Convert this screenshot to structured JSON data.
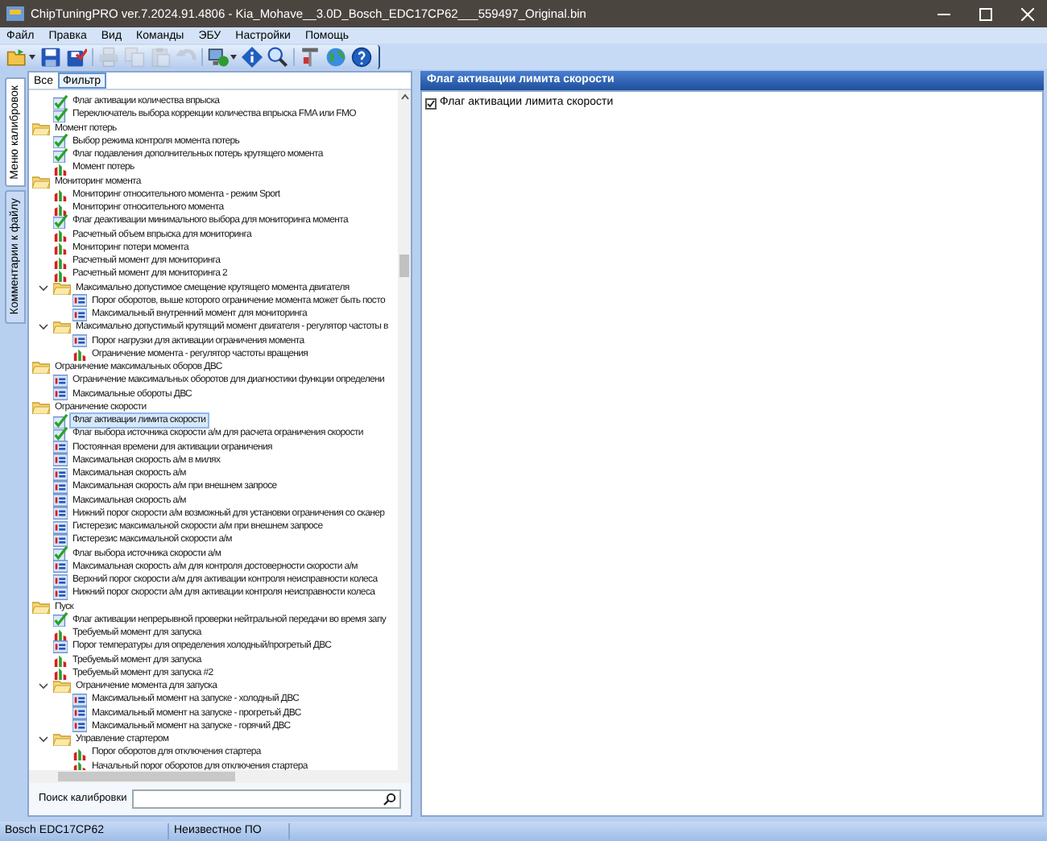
{
  "window": {
    "title": "ChipTuningPRO ver.7.2024.91.4806 - Kia_Mohave__3.0D_Bosch_EDC17CP62___559497_Original.bin"
  },
  "menu": [
    "Файл",
    "Правка",
    "Вид",
    "Команды",
    "ЭБУ",
    "Настройки",
    "Помощь"
  ],
  "toolbar": [
    {
      "kind": "open",
      "disabled": false,
      "dropdown": true
    },
    {
      "kind": "save",
      "disabled": false,
      "dropdown": false
    },
    {
      "kind": "save-as",
      "disabled": false,
      "dropdown": false
    },
    {
      "kind": "print",
      "disabled": true,
      "dropdown": false
    },
    {
      "kind": "copy",
      "disabled": true,
      "dropdown": false
    },
    {
      "kind": "paste",
      "disabled": true,
      "dropdown": false
    },
    {
      "kind": "undo",
      "disabled": true,
      "dropdown": false
    },
    {
      "kind": "connect",
      "disabled": false,
      "dropdown": true
    },
    {
      "kind": "info",
      "disabled": false,
      "dropdown": false
    },
    {
      "kind": "zoom",
      "disabled": false,
      "dropdown": false
    },
    {
      "kind": "tools",
      "disabled": false,
      "dropdown": false
    },
    {
      "kind": "web",
      "disabled": false,
      "dropdown": false
    },
    {
      "kind": "help",
      "disabled": false,
      "dropdown": false
    }
  ],
  "side_tabs": [
    {
      "label": "Меню калибровок",
      "selected": true
    },
    {
      "label": "Комментарии к файлу",
      "selected": false
    }
  ],
  "filter_tabs": [
    {
      "label": "Все",
      "selected": false
    },
    {
      "label": "Фильтр",
      "selected": true
    }
  ],
  "tree": [
    {
      "kind": "continued",
      "expanded": true,
      "children": [
        {
          "kind": "flag",
          "label": "Флаг активации количества впрыска",
          "selected": false
        },
        {
          "kind": "flag",
          "label": "Переключатель выбора коррекции количества впрыска FMA или FMO",
          "selected": false
        }
      ]
    },
    {
      "kind": "folder",
      "label": "Момент потерь",
      "expanded": true,
      "children": [
        {
          "kind": "flag",
          "label": "Выбор режима контроля момента потерь",
          "selected": false
        },
        {
          "kind": "flag",
          "label": "Флаг подавления дополнительных потерь крутящего момента",
          "selected": false
        },
        {
          "kind": "curve",
          "label": "Момент потерь",
          "selected": false
        }
      ]
    },
    {
      "kind": "folder",
      "label": "Мониторинг момента",
      "expanded": true,
      "children": [
        {
          "kind": "curve",
          "label": "Мониторинг относительного момента - режим Sport",
          "selected": false
        },
        {
          "kind": "curve",
          "label": "Мониторинг относительного момента",
          "selected": false
        },
        {
          "kind": "flag",
          "label": "Флаг деактивации минимального выбора для мониторинга момента",
          "selected": false
        },
        {
          "kind": "curve",
          "label": "Расчетный объем впрыска для мониторинга",
          "selected": false
        },
        {
          "kind": "curve",
          "label": "Мониторинг потери момента",
          "selected": false
        },
        {
          "kind": "curve",
          "label": "Расчетный момент для мониторинга",
          "selected": false
        },
        {
          "kind": "curve",
          "label": "Расчетный момент для мониторинга 2",
          "selected": false
        },
        {
          "kind": "folder",
          "label": "Максимально допустимое смещение крутящего момента двигателя",
          "expanded": true,
          "children": [
            {
              "kind": "value",
              "label": "Порог оборотов, выше которого ограничение момента может быть посто",
              "selected": false
            },
            {
              "kind": "value",
              "label": "Максимальный внутренний момент для мониторинга",
              "selected": false
            }
          ]
        },
        {
          "kind": "folder",
          "label": "Максимально допустимый крутящий момент двигателя - регулятор частоты в",
          "expanded": true,
          "children": [
            {
              "kind": "value",
              "label": "Порог нагрузки для активации ограничения момента",
              "selected": false
            },
            {
              "kind": "curve",
              "label": "Ограничение момента - регулятор частоты вращения",
              "selected": false
            }
          ]
        }
      ]
    },
    {
      "kind": "folder",
      "label": "Ограничение максимальных оборов ДВС",
      "expanded": true,
      "children": [
        {
          "kind": "value",
          "label": "Ограничение максимальных оборотов для диагностики функции определени",
          "selected": false
        },
        {
          "kind": "value",
          "label": "Максимальные обороты ДВС",
          "selected": false
        }
      ]
    },
    {
      "kind": "folder",
      "label": "Ограничение скорости",
      "expanded": true,
      "children": [
        {
          "kind": "flag",
          "label": "Флаг активации лимита скорости",
          "selected": true
        },
        {
          "kind": "flag",
          "label": "Флаг выбора источника скорости а/м для расчета ограничения скорости",
          "selected": false
        },
        {
          "kind": "value",
          "label": "Постоянная времени для активации ограничения",
          "selected": false
        },
        {
          "kind": "value",
          "label": "Максимальная скорость а/м в милях",
          "selected": false
        },
        {
          "kind": "value",
          "label": "Максимальная скорость а/м",
          "selected": false
        },
        {
          "kind": "value",
          "label": "Максимальная скорость а/м при внешнем запросе",
          "selected": false
        },
        {
          "kind": "value",
          "label": "Максимальная скорость а/м",
          "selected": false
        },
        {
          "kind": "value",
          "label": "Нижний порог скорости а/м возможный для установки ограничения со сканер",
          "selected": false
        },
        {
          "kind": "value",
          "label": "Гистерезис максимальной скорости а/м при внешнем запросе",
          "selected": false
        },
        {
          "kind": "value",
          "label": "Гистерезис максимальной скорости а/м",
          "selected": false
        },
        {
          "kind": "flag",
          "label": "Флаг выбора источника скорости а/м",
          "selected": false
        },
        {
          "kind": "value",
          "label": "Максимальная скорость а/м для контроля достоверности скорости а/м",
          "selected": false
        },
        {
          "kind": "value",
          "label": "Верхний порог скорости а/м для активации контроля неисправности колеса",
          "selected": false
        },
        {
          "kind": "value",
          "label": "Нижний порог скорости а/м для активации контроля неисправности колеса",
          "selected": false
        }
      ]
    },
    {
      "kind": "folder",
      "label": "Пуск",
      "expanded": true,
      "children": [
        {
          "kind": "flag",
          "label": "Флаг активации непрерывной проверки нейтральной передачи во время запу",
          "selected": false
        },
        {
          "kind": "curve",
          "label": "Требуемый момент для запуска",
          "selected": false
        },
        {
          "kind": "value",
          "label": "Порог температуры для определения холодный/прогретый ДВС",
          "selected": false
        },
        {
          "kind": "curve",
          "label": "Требуемый момент для запуска",
          "selected": false
        },
        {
          "kind": "curve",
          "label": "Требуемый момент для запуска #2",
          "selected": false
        },
        {
          "kind": "folder",
          "label": "Ограничение момента для запуска",
          "expanded": true,
          "children": [
            {
              "kind": "value",
              "label": "Максимальный момент на запуске - холодный ДВС",
              "selected": false
            },
            {
              "kind": "value",
              "label": "Максимальный момент на запуске - прогретый ДВС",
              "selected": false
            },
            {
              "kind": "value",
              "label": "Максимальный момент на запуске - горячий ДВС",
              "selected": false
            }
          ]
        },
        {
          "kind": "folder",
          "label": "Управление стартером",
          "expanded": true,
          "children": [
            {
              "kind": "curve",
              "label": "Порог оборотов для отключения стартера",
              "selected": false
            },
            {
              "kind": "curve",
              "label": "Начальный порог оборотов для отключения стартера",
              "selected": false
            }
          ]
        }
      ]
    }
  ],
  "search": {
    "label": "Поиск калибровки"
  },
  "detail": {
    "title": "Флаг активации лимита скорости",
    "checkbox": {
      "label": "Флаг активации лимита скорости",
      "checked": true
    }
  },
  "status_bar": [
    "Bosch EDC17CP62",
    "Неизвестное ПО"
  ]
}
